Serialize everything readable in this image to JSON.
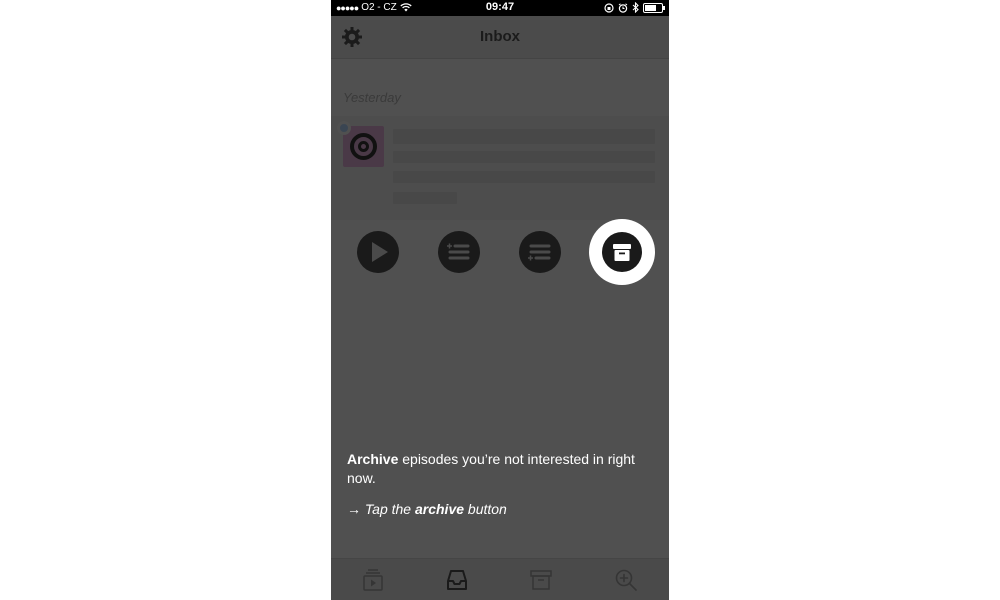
{
  "status_bar": {
    "signal": "●●●●●",
    "carrier": "O2 - CZ",
    "time": "09:47"
  },
  "nav": {
    "title": "Inbox",
    "settings_icon": "gear-icon"
  },
  "list": {
    "section_header": "Yesterday"
  },
  "actions": [
    {
      "icon": "play-icon"
    },
    {
      "icon": "play-next-icon"
    },
    {
      "icon": "play-last-icon"
    },
    {
      "icon": "archive-icon",
      "highlighted": true
    }
  ],
  "tip": {
    "bold_word": "Archive",
    "line1_rest": " episodes you’re not interested in right now.",
    "arrow": "→",
    "line2_prefix": " Tap the ",
    "line2_bold": "archive",
    "line2_suffix": " button"
  },
  "tab_bar": [
    {
      "icon": "queue-icon"
    },
    {
      "icon": "inbox-icon",
      "active": true
    },
    {
      "icon": "archive-icon"
    },
    {
      "icon": "search-add-icon"
    }
  ],
  "colors": {
    "overlay": "#505050",
    "button_dark": "#1a1a1a",
    "highlight": "#ffffff"
  }
}
